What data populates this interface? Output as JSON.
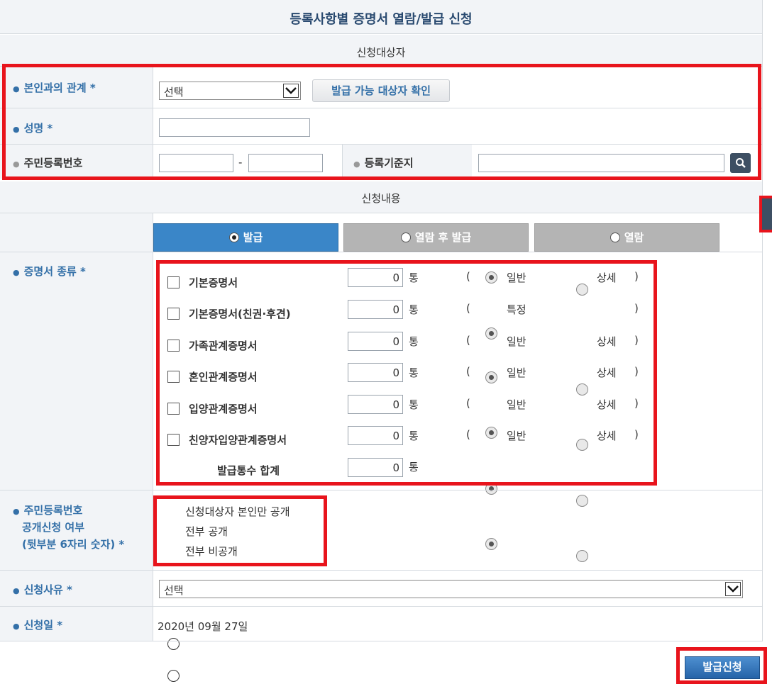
{
  "page_title": "등록사항별 증명서 열람/발급 신청",
  "target_section": {
    "heading": "신청대상자",
    "relation_label": "본인과의 관계 *",
    "relation_value": "선택",
    "check_target_button": "발급 가능 대상자 확인",
    "name_label": "성명 *",
    "rrn_label": "주민등록번호",
    "rrn_dash": "-",
    "registry_label": "등록기준지"
  },
  "request_section": {
    "heading": "신청내용",
    "tabs": [
      {
        "label": "발급",
        "selected": true
      },
      {
        "label": "열람 후 발급",
        "selected": false
      },
      {
        "label": "열람",
        "selected": false
      }
    ],
    "cert_type_label": "증명서 종류 *",
    "unit": "통",
    "open_paren": "(",
    "close_paren": ")",
    "certificates": [
      {
        "name": "기본증명서",
        "count": "0",
        "opt1": "일반",
        "opt2": "상세"
      },
      {
        "name": "기본증명서(친권·후견)",
        "count": "0",
        "opt1": "특정",
        "opt2": ""
      },
      {
        "name": "가족관계증명서",
        "count": "0",
        "opt1": "일반",
        "opt2": "상세"
      },
      {
        "name": "혼인관계증명서",
        "count": "0",
        "opt1": "일반",
        "opt2": "상세"
      },
      {
        "name": "입양관계증명서",
        "count": "0",
        "opt1": "일반",
        "opt2": "상세"
      },
      {
        "name": "친양자입양관계증명서",
        "count": "0",
        "opt1": "일반",
        "opt2": "상세"
      }
    ],
    "total_label": "발급통수 합계",
    "total_value": "0",
    "disclosure_label_1": "주민등록번호",
    "disclosure_label_2": "공개신청 여부",
    "disclosure_label_3": "(뒷부분 6자리 숫자) *",
    "disclosure_options": [
      {
        "label": "신청대상자 본인만 공개",
        "selected": false
      },
      {
        "label": "전부 공개",
        "selected": false
      },
      {
        "label": "전부 비공개",
        "selected": true
      }
    ],
    "reason_label": "신청사유 *",
    "reason_value": "선택",
    "date_label": "신청일 *",
    "date_value": "2020년 09월 27일"
  },
  "submit_button": "발급신청",
  "icons": [
    "search-icon",
    "chevron-down-icon"
  ],
  "colors": {
    "accent": "#3470a8",
    "highlight": "#e8141c",
    "tab_active": "#3a86c8",
    "tab_inactive": "#b4b4b4"
  }
}
